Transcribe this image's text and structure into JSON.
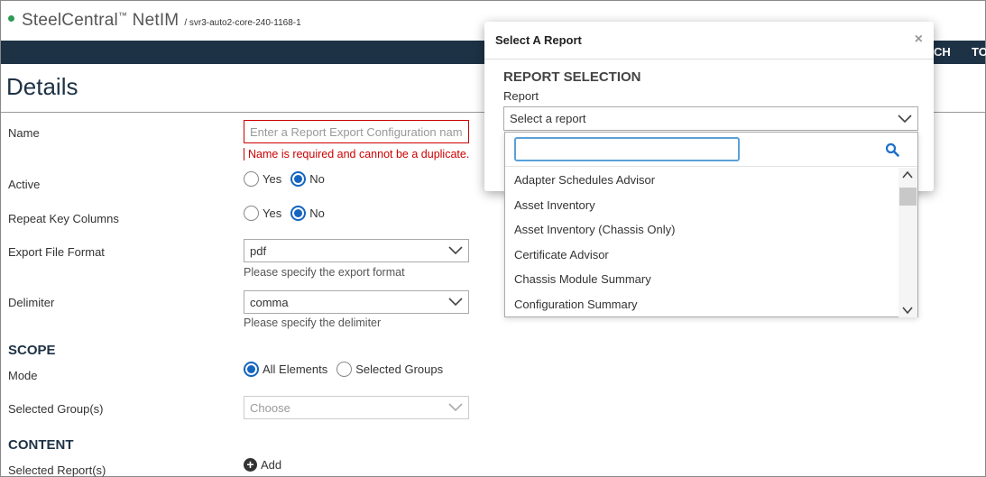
{
  "header": {
    "brand": "SteelCentral",
    "brand_tm": "™",
    "brand_suffix": " NetIM",
    "host": "/ svr3-auto2-core-240-1168-1"
  },
  "nav": {
    "items": [
      "CH",
      "TO"
    ]
  },
  "page": {
    "title": "Details"
  },
  "form": {
    "name_label": "Name",
    "name_placeholder": "Enter a Report Export Configuration name",
    "name_error": "Name is required and cannot be a duplicate.",
    "active_label": "Active",
    "repeat_label": "Repeat Key Columns",
    "yes": "Yes",
    "no": "No",
    "format_label": "Export File Format",
    "format_value": "pdf",
    "format_hint": "Please specify the export format",
    "delimiter_label": "Delimiter",
    "delimiter_value": "comma",
    "delimiter_hint": "Please specify the delimiter",
    "scope_heading": "SCOPE",
    "mode_label": "Mode",
    "mode_all": "All Elements",
    "mode_selected": "Selected Groups",
    "groups_label": "Selected Group(s)",
    "groups_placeholder": "Choose",
    "content_heading": "CONTENT",
    "reports_label": "Selected Report(s)",
    "add_label": "Add"
  },
  "modal": {
    "title": "Select A Report",
    "close": "×",
    "section": "REPORT SELECTION",
    "report_label": "Report",
    "report_placeholder": "Select a report"
  },
  "dropdown": {
    "search_value": "",
    "items": [
      "Adapter Schedules Advisor",
      "Asset Inventory",
      "Asset Inventory (Chassis Only)",
      "Certificate Advisor",
      "Chassis Module Summary",
      "Configuration Summary"
    ]
  },
  "colors": {
    "navy": "#1e3246",
    "accent": "#1565c0",
    "error": "#cc0000",
    "status": "#2e9a55"
  }
}
